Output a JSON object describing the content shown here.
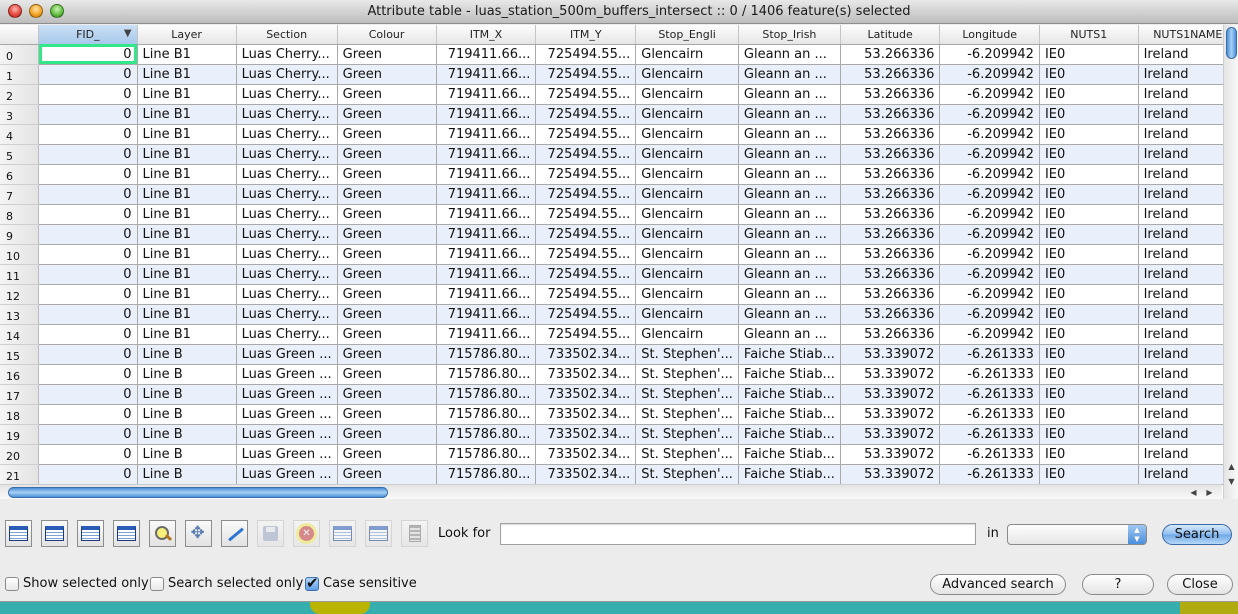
{
  "window": {
    "title": "Attribute table - luas_station_500m_buffers_intersect :: 0 / 1406 feature(s) selected"
  },
  "table": {
    "columns": [
      "FID_",
      "Layer",
      "Section",
      "Colour",
      "ITM_X",
      "ITM_Y",
      "Stop_Engli",
      "Stop_Irish",
      "Latitude",
      "Longitude",
      "NUTS1",
      "NUTS1NAME"
    ],
    "sorted_column": "FID_",
    "rows": [
      {
        "n": "0",
        "cells": [
          "0",
          "Line B1",
          "Luas Cherry...",
          "Green",
          "719411.66...",
          "725494.55...",
          "Glencairn",
          "Gleann an ...",
          "53.266336",
          "-6.209942",
          "IE0",
          "Ireland"
        ]
      },
      {
        "n": "1",
        "cells": [
          "0",
          "Line B1",
          "Luas Cherry...",
          "Green",
          "719411.66...",
          "725494.55...",
          "Glencairn",
          "Gleann an ...",
          "53.266336",
          "-6.209942",
          "IE0",
          "Ireland"
        ]
      },
      {
        "n": "2",
        "cells": [
          "0",
          "Line B1",
          "Luas Cherry...",
          "Green",
          "719411.66...",
          "725494.55...",
          "Glencairn",
          "Gleann an ...",
          "53.266336",
          "-6.209942",
          "IE0",
          "Ireland"
        ]
      },
      {
        "n": "3",
        "cells": [
          "0",
          "Line B1",
          "Luas Cherry...",
          "Green",
          "719411.66...",
          "725494.55...",
          "Glencairn",
          "Gleann an ...",
          "53.266336",
          "-6.209942",
          "IE0",
          "Ireland"
        ]
      },
      {
        "n": "4",
        "cells": [
          "0",
          "Line B1",
          "Luas Cherry...",
          "Green",
          "719411.66...",
          "725494.55...",
          "Glencairn",
          "Gleann an ...",
          "53.266336",
          "-6.209942",
          "IE0",
          "Ireland"
        ]
      },
      {
        "n": "5",
        "cells": [
          "0",
          "Line B1",
          "Luas Cherry...",
          "Green",
          "719411.66...",
          "725494.55...",
          "Glencairn",
          "Gleann an ...",
          "53.266336",
          "-6.209942",
          "IE0",
          "Ireland"
        ]
      },
      {
        "n": "6",
        "cells": [
          "0",
          "Line B1",
          "Luas Cherry...",
          "Green",
          "719411.66...",
          "725494.55...",
          "Glencairn",
          "Gleann an ...",
          "53.266336",
          "-6.209942",
          "IE0",
          "Ireland"
        ]
      },
      {
        "n": "7",
        "cells": [
          "0",
          "Line B1",
          "Luas Cherry...",
          "Green",
          "719411.66...",
          "725494.55...",
          "Glencairn",
          "Gleann an ...",
          "53.266336",
          "-6.209942",
          "IE0",
          "Ireland"
        ]
      },
      {
        "n": "8",
        "cells": [
          "0",
          "Line B1",
          "Luas Cherry...",
          "Green",
          "719411.66...",
          "725494.55...",
          "Glencairn",
          "Gleann an ...",
          "53.266336",
          "-6.209942",
          "IE0",
          "Ireland"
        ]
      },
      {
        "n": "9",
        "cells": [
          "0",
          "Line B1",
          "Luas Cherry...",
          "Green",
          "719411.66...",
          "725494.55...",
          "Glencairn",
          "Gleann an ...",
          "53.266336",
          "-6.209942",
          "IE0",
          "Ireland"
        ]
      },
      {
        "n": "10",
        "cells": [
          "0",
          "Line B1",
          "Luas Cherry...",
          "Green",
          "719411.66...",
          "725494.55...",
          "Glencairn",
          "Gleann an ...",
          "53.266336",
          "-6.209942",
          "IE0",
          "Ireland"
        ]
      },
      {
        "n": "11",
        "cells": [
          "0",
          "Line B1",
          "Luas Cherry...",
          "Green",
          "719411.66...",
          "725494.55...",
          "Glencairn",
          "Gleann an ...",
          "53.266336",
          "-6.209942",
          "IE0",
          "Ireland"
        ]
      },
      {
        "n": "12",
        "cells": [
          "0",
          "Line B1",
          "Luas Cherry...",
          "Green",
          "719411.66...",
          "725494.55...",
          "Glencairn",
          "Gleann an ...",
          "53.266336",
          "-6.209942",
          "IE0",
          "Ireland"
        ]
      },
      {
        "n": "13",
        "cells": [
          "0",
          "Line B1",
          "Luas Cherry...",
          "Green",
          "719411.66...",
          "725494.55...",
          "Glencairn",
          "Gleann an ...",
          "53.266336",
          "-6.209942",
          "IE0",
          "Ireland"
        ]
      },
      {
        "n": "14",
        "cells": [
          "0",
          "Line B1",
          "Luas Cherry...",
          "Green",
          "719411.66...",
          "725494.55...",
          "Glencairn",
          "Gleann an ...",
          "53.266336",
          "-6.209942",
          "IE0",
          "Ireland"
        ]
      },
      {
        "n": "15",
        "cells": [
          "0",
          "Line B",
          "Luas Green ...",
          "Green",
          "715786.80...",
          "733502.34...",
          "St. Stephen'...",
          "Faiche Stiab...",
          "53.339072",
          "-6.261333",
          "IE0",
          "Ireland"
        ]
      },
      {
        "n": "16",
        "cells": [
          "0",
          "Line B",
          "Luas Green ...",
          "Green",
          "715786.80...",
          "733502.34...",
          "St. Stephen'...",
          "Faiche Stiab...",
          "53.339072",
          "-6.261333",
          "IE0",
          "Ireland"
        ]
      },
      {
        "n": "17",
        "cells": [
          "0",
          "Line B",
          "Luas Green ...",
          "Green",
          "715786.80...",
          "733502.34...",
          "St. Stephen'...",
          "Faiche Stiab...",
          "53.339072",
          "-6.261333",
          "IE0",
          "Ireland"
        ]
      },
      {
        "n": "18",
        "cells": [
          "0",
          "Line B",
          "Luas Green ...",
          "Green",
          "715786.80...",
          "733502.34...",
          "St. Stephen'...",
          "Faiche Stiab...",
          "53.339072",
          "-6.261333",
          "IE0",
          "Ireland"
        ]
      },
      {
        "n": "19",
        "cells": [
          "0",
          "Line B",
          "Luas Green ...",
          "Green",
          "715786.80...",
          "733502.34...",
          "St. Stephen'...",
          "Faiche Stiab...",
          "53.339072",
          "-6.261333",
          "IE0",
          "Ireland"
        ]
      },
      {
        "n": "20",
        "cells": [
          "0",
          "Line B",
          "Luas Green ...",
          "Green",
          "715786.80...",
          "733502.34...",
          "St. Stephen'...",
          "Faiche Stiab...",
          "53.339072",
          "-6.261333",
          "IE0",
          "Ireland"
        ]
      },
      {
        "n": "21",
        "cells": [
          "0",
          "Line B",
          "Luas Green ...",
          "Green",
          "715786.80...",
          "733502.34...",
          "St. Stephen'...",
          "Faiche Stiab...",
          "53.339072",
          "-6.261333",
          "IE0",
          "Ireland"
        ]
      }
    ]
  },
  "toolbar": {
    "buttons": [
      {
        "name": "unselect-all",
        "icon": "table-icon",
        "enabled": true
      },
      {
        "name": "selected-to-top",
        "icon": "table-move-top-icon",
        "enabled": true
      },
      {
        "name": "invert-selection",
        "icon": "table-invert-icon",
        "enabled": true
      },
      {
        "name": "copy-selected-rows",
        "icon": "table-copy-icon",
        "enabled": true
      },
      {
        "name": "zoom-to-selection",
        "icon": "magnifier-icon",
        "enabled": true
      },
      {
        "name": "pan-to-selection",
        "icon": "pan-move-icon",
        "enabled": true
      },
      {
        "name": "toggle-editing",
        "icon": "pencil-icon",
        "enabled": true
      },
      {
        "name": "save-edits",
        "icon": "floppy-save-icon",
        "enabled": false
      },
      {
        "name": "delete-selected",
        "icon": "delete-icon",
        "enabled": false
      },
      {
        "name": "new-column",
        "icon": "new-column-icon",
        "enabled": false
      },
      {
        "name": "delete-column",
        "icon": "delete-column-icon",
        "enabled": false
      },
      {
        "name": "field-calculator",
        "icon": "calculator-icon",
        "enabled": false
      }
    ]
  },
  "search": {
    "look_for_label": "Look for",
    "look_for_value": "",
    "in_label": "in",
    "field_selected": "",
    "search_button": "Search"
  },
  "options": {
    "show_selected_only": {
      "label": "Show selected only",
      "checked": false
    },
    "search_selected_only": {
      "label": "Search selected only",
      "checked": false
    },
    "case_sensitive": {
      "label": "Case sensitive",
      "checked": true
    }
  },
  "buttons": {
    "advanced_search": "Advanced search",
    "help": "?",
    "close": "Close"
  },
  "colors": {
    "selected_header": "#a7c8ec",
    "alt_row": "#e9f0fb",
    "focus_cell": "#34e68a"
  }
}
